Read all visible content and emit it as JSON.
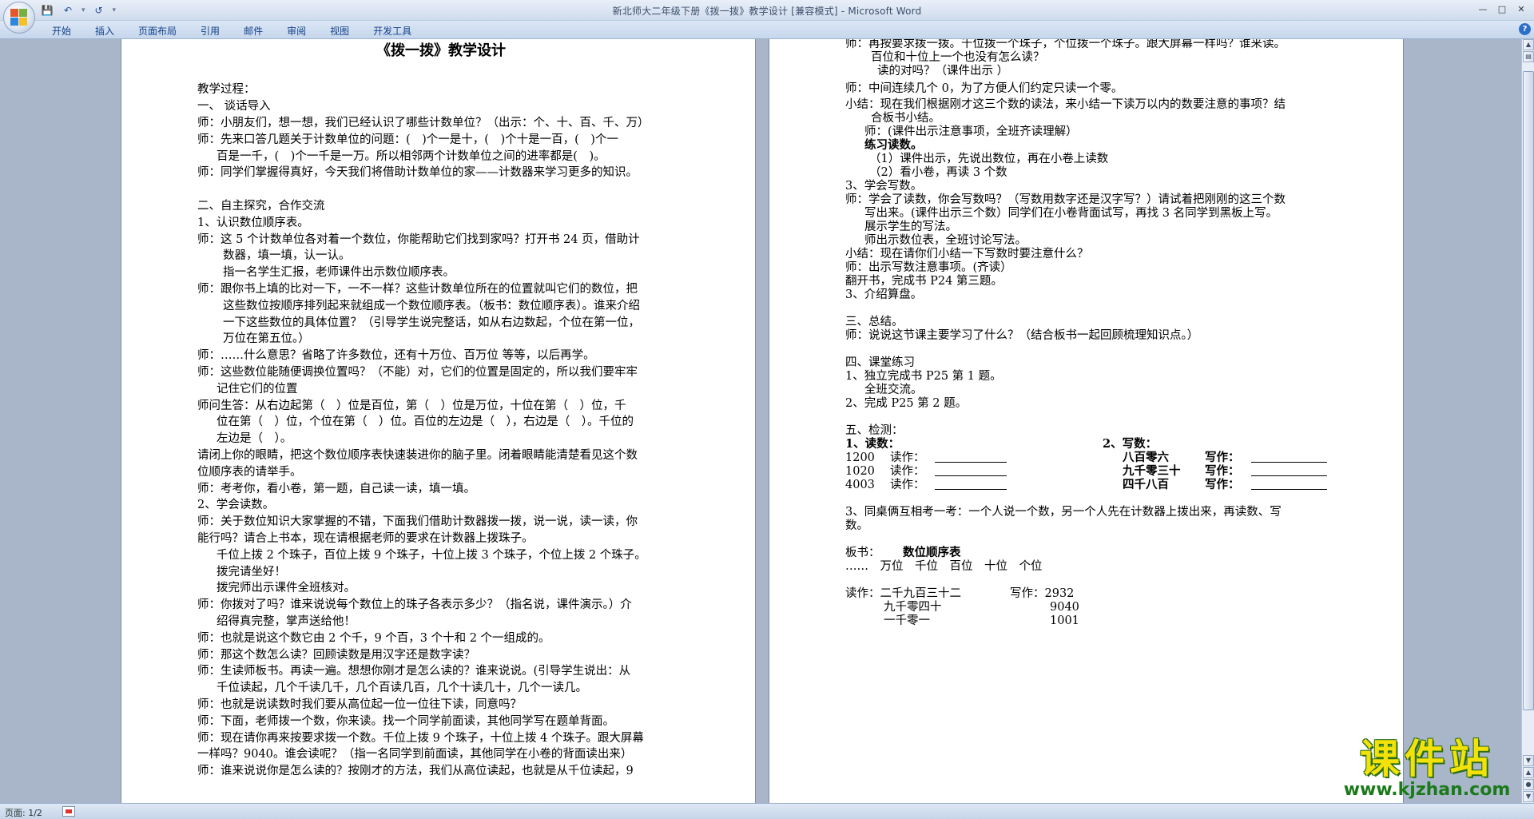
{
  "window": {
    "title": "新北师大二年级下册《拨一拨》教学设计 [兼容模式] - Microsoft Word",
    "controls": [
      "—",
      "□",
      "✕"
    ]
  },
  "ribbon": {
    "tabs": [
      "开始",
      "插入",
      "页面布局",
      "引用",
      "邮件",
      "审阅",
      "视图",
      "开发工具"
    ]
  },
  "status": {
    "page": "页面: 1/2"
  },
  "watermark": {
    "main": "课件站",
    "url": "www.kjzhan.com"
  },
  "page1": [
    "《拨一拨》教学设计",
    "",
    "教学过程：",
    "一、    谈话导入",
    "师：小朋友们，想一想，我们已经认识了哪些计数单位？（出示：个、十、百、千、万）",
    "师：先来口答几题关于计数单位的问题：(　)个一是十，(　)个十是一百，(　)个一",
    "百是一千，(　)个一千是一万。所以相邻两个计数单位之间的进率都是(　)。",
    "师：同学们掌握得真好，今天我们将借助计数单位的家——计数器来学习更多的知识。",
    "",
    "二、自主探究，合作交流",
    "1、认识数位顺序表。",
    "师：这 5 个计数单位各对着一个数位，你能帮助它们找到家吗？打开书 24 页，借助计",
    "数器，填一填，认一认。",
    "指一名学生汇报，老师课件出示数位顺序表。",
    "师：跟你书上填的比对一下，一不一样？这些计数单位所在的位置就叫它们的数位，把",
    "这些数位按顺序排列起来就组成一个数位顺序表。（板书：数位顺序表）。谁来介绍",
    "一下这些数位的具体位置？（引导学生说完整话，如从右边数起，个位在第一位，",
    "万位在第五位。）",
    "师：……什么意思？省略了许多数位，还有十万位、百万位 等等，以后再学。",
    "师：这些数位能随便调换位置吗？（不能）对，它们的位置是固定的，所以我们要牢牢",
    "记住它们的位置",
    "师问生答：从右边起第（　）位是百位，第（　）位是万位，十位在第（　）位，千",
    "位在第（　）位，个位在第（　）位。百位的左边是（　），右边是（　）。千位的",
    "左边是（　）。",
    "请闭上你的眼睛，把这个数位顺序表快速装进你的脑子里。闭着眼睛能清楚看见这个数",
    "位顺序表的请举手。",
    "师：考考你，看小卷，第一题，自己读一读，填一填。",
    "2、学会读数。",
    "师：关于数位知识大家掌握的不错，下面我们借助计数器拨一拨，说一说，读一读，你",
    "能行吗？请合上书本，现在请根据老师的要求在计数器上拨珠子。",
    "千位上拨 2 个珠子，百位上拨 9 个珠子，十位上拨 3 个珠子，个位上拨 2 个珠子。",
    "拨完请坐好！",
    "拨完师出示课件全班核对。",
    "师：你拨对了吗？谁来说说每个数位上的珠子各表示多少？（指名说，课件演示。）介",
    "绍得真完整，掌声送给他！",
    "师：也就是说这个数它由 2 个千，9 个百，3 个十和 2 个一组成的。",
    "师：那这个数怎么读？回顾读数是用汉字还是数字读？",
    "师：生读师板书。再读一遍。想想你刚才是怎么读的？谁来说说。(引导学生说出：从",
    "千位读起，几个千读几千，几个百读几百，几个十读几十，几个一读几。",
    "师：也就是说读数时我们要从高位起一位一位往下读，同意吗？",
    "师：下面，老师拨一个数，你来读。找一个同学前面读，其他同学写在题单背面。",
    "师：现在请你再来按要求拨一个数。千位上拨 9 个珠子，十位上拨 4 个珠子。跟大屏幕",
    "一样吗？9040。谁会读呢？（指一名同学到前面读，其他同学在小卷的背面读出来）",
    "师：谁来说说你是怎么读的？按刚才的方法，我们从高位读起，也就是从千位读起，9"
  ],
  "page2": [
    "师：再按要求拨一拨。千位拨一个珠子，个位拨一个珠子。跟大屏幕一样吗？谁来读。",
    "百位和十位上一个也没有怎么读？",
    "读的对吗？（课件出示 ）",
    "师：中间连续几个 0，为了方便人们约定只读一个零。",
    "小结：现在我们根据刚才这三个数的读法，来小结一下读万以内的数要注意的事项？结",
    "合板书小结。",
    "师：(课件出示注意事项，全班齐读理解）",
    "练习读数。",
    "（1）课件出示，先说出数位，再在小卷上读数",
    "（2）看小卷，再读 3 个数",
    "3、学会写数。",
    "师：学会了读数，你会写数吗？（写数用数字还是汉字写？）请试着把刚刚的这三个数",
    "写出来。(课件出示三个数）同学们在小卷背面试写，再找 3 名同学到黑板上写。",
    "展示学生的写法。",
    "师出示数位表，全班讨论写法。",
    "小结：现在请你们小结一下写数时要注意什么？",
    "师：出示写数注意事项。(齐读）",
    "翻开书，完成书 P24 第三题。",
    "3、介绍算盘。",
    "",
    "三、总结。",
    "师：说说这节课主要学习了什么？（结合板书一起回顾梳理知识点。）",
    "",
    "四、课堂练习",
    "1、独立完成书 P25 第 1 题。",
    "全班交流。",
    "2、完成 P25 第 2 题。",
    "",
    "五、检测：",
    "1、读数：",
    "1200",
    "1020",
    "4003",
    "读作：",
    "2、写数：",
    "八百零六",
    "九千零三十",
    "四千八百",
    "写作：",
    "3、同桌俩互相考一考：一个人说一个数，另一个人先在计数器上拨出来，再读数、写",
    "数。",
    "板书：",
    "数位顺序表",
    "……　万位　千位　百位　十位　个位",
    "读作：二千九百三十二",
    "写作：2932",
    "九千零四十",
    "9040",
    "一千零一",
    "1001"
  ]
}
